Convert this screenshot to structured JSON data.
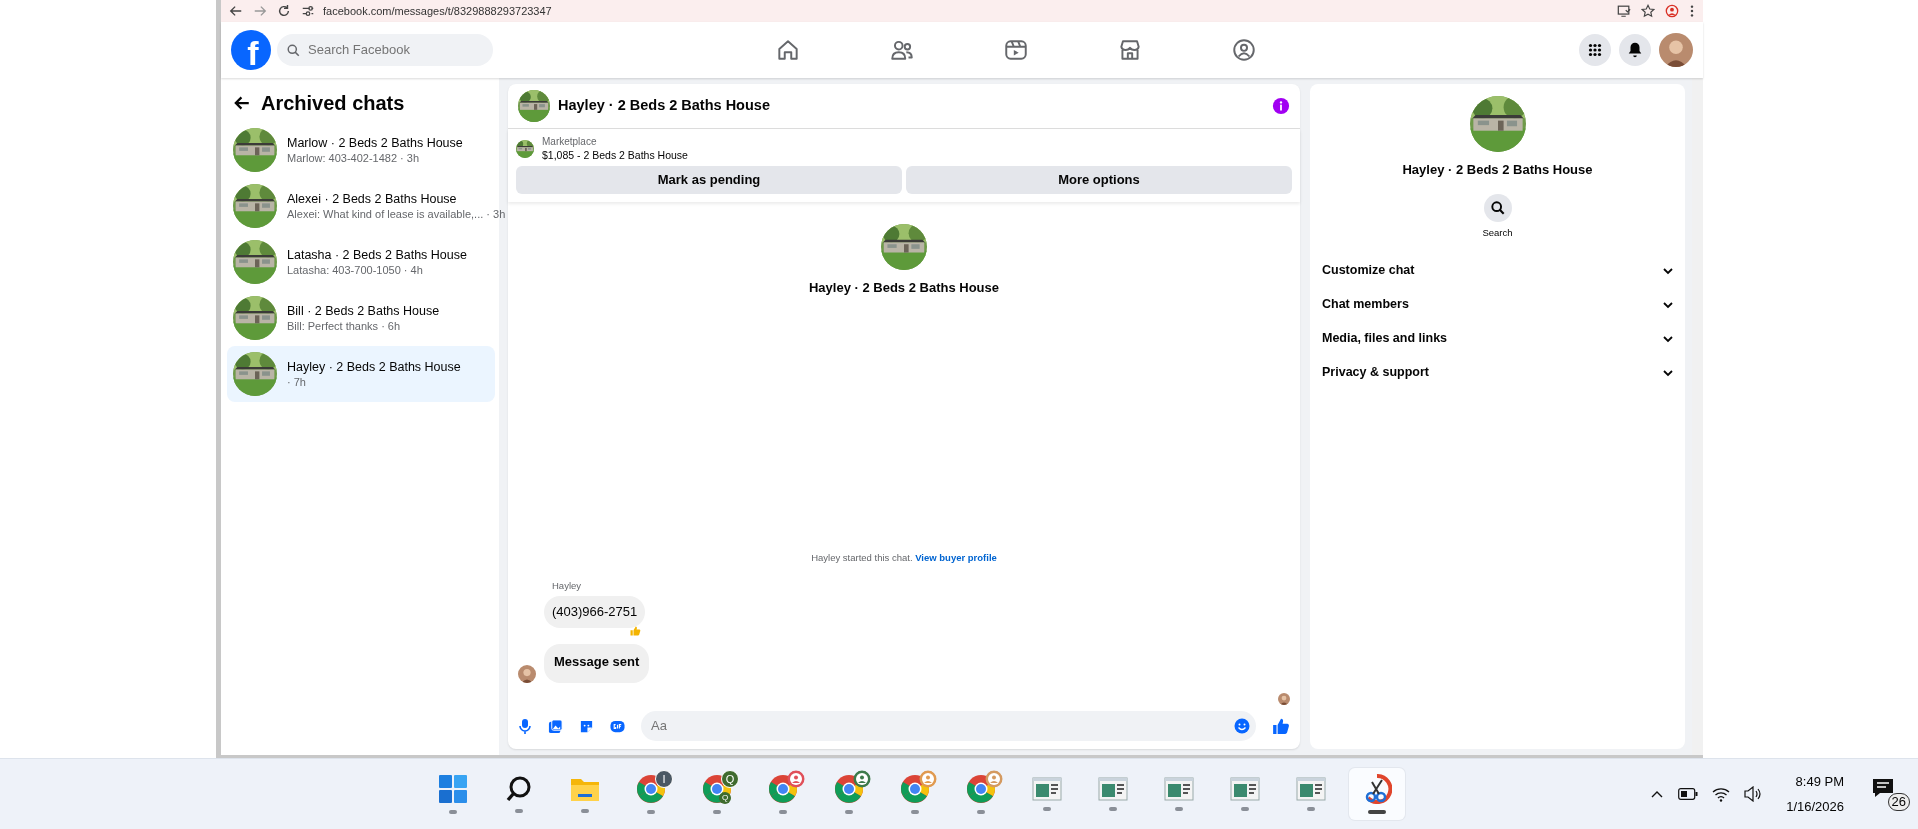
{
  "browser": {
    "url": "facebook.com/messages/t/8329888293723347"
  },
  "header": {
    "logo": "f",
    "search_placeholder": "Search Facebook"
  },
  "sidebar": {
    "title": "Archived chats",
    "chats": [
      {
        "name": "Marlow · 2 Beds 2 Baths House",
        "preview": "Marlow: 403-402-1482 · 3h",
        "selected": false
      },
      {
        "name": "Alexei · 2 Beds 2 Baths House",
        "preview": "Alexei: What kind of lease is available,... · 3h",
        "selected": false
      },
      {
        "name": "Latasha · 2 Beds 2 Baths House",
        "preview": "Latasha: 403-700-1050 · 4h",
        "selected": false
      },
      {
        "name": "Bill · 2 Beds 2 Baths House",
        "preview": "Bill: Perfect thanks · 6h",
        "selected": false
      },
      {
        "name": "Hayley · 2 Beds 2 Baths House",
        "preview": "· 7h",
        "selected": true
      }
    ]
  },
  "chat": {
    "title": "Hayley · 2 Beds 2 Baths House",
    "listing": {
      "source": "Marketplace",
      "title": "$1,085 - 2 Beds 2 Baths House"
    },
    "actions": [
      "Mark as pending",
      "More options"
    ],
    "intro_name": "Hayley · 2 Beds 2 Baths House",
    "notice": {
      "text": "Hayley started this chat.",
      "link": "View buyer profile"
    },
    "messages": [
      {
        "kind": "text",
        "sender": "Hayley",
        "text": "(403)966-2751",
        "reacted": true
      },
      {
        "kind": "status",
        "text": "Message sent",
        "reacted": false
      }
    ],
    "composer": {
      "placeholder": "Aa"
    }
  },
  "details": {
    "title": "Hayley · 2 Beds 2 Baths House",
    "search_label": "Search",
    "sections": [
      {
        "label": "Customize chat",
        "expanded": false
      },
      {
        "label": "Chat members",
        "expanded": false
      },
      {
        "label": "Media, files and links",
        "expanded": false
      },
      {
        "label": "Privacy & support",
        "expanded": false
      }
    ]
  },
  "taskbar": {
    "apps": [
      {
        "kind": "start",
        "selected": false
      },
      {
        "kind": "search",
        "selected": false
      },
      {
        "kind": "explorer",
        "selected": false
      },
      {
        "kind": "chrome",
        "selected": false,
        "badge": "I",
        "color": "#4b5863"
      },
      {
        "kind": "chrome",
        "selected": false,
        "badge": "Q",
        "sub_badge": "Q",
        "color": "#3f6b2e"
      },
      {
        "kind": "chrome",
        "selected": false,
        "color": "#e0505a"
      },
      {
        "kind": "chrome",
        "selected": false,
        "color": "#3d7a4a"
      },
      {
        "kind": "chrome",
        "selected": false,
        "color": "#e09a50"
      },
      {
        "kind": "chrome",
        "selected": false,
        "color": "#d49a60"
      },
      {
        "kind": "window",
        "selected": false
      },
      {
        "kind": "window",
        "selected": false
      },
      {
        "kind": "window",
        "selected": false
      },
      {
        "kind": "window",
        "selected": false
      },
      {
        "kind": "window",
        "selected": false
      },
      {
        "kind": "snip",
        "selected": true
      }
    ],
    "time": "8:49 PM",
    "date": "1/16/2026",
    "notifications": "26"
  }
}
